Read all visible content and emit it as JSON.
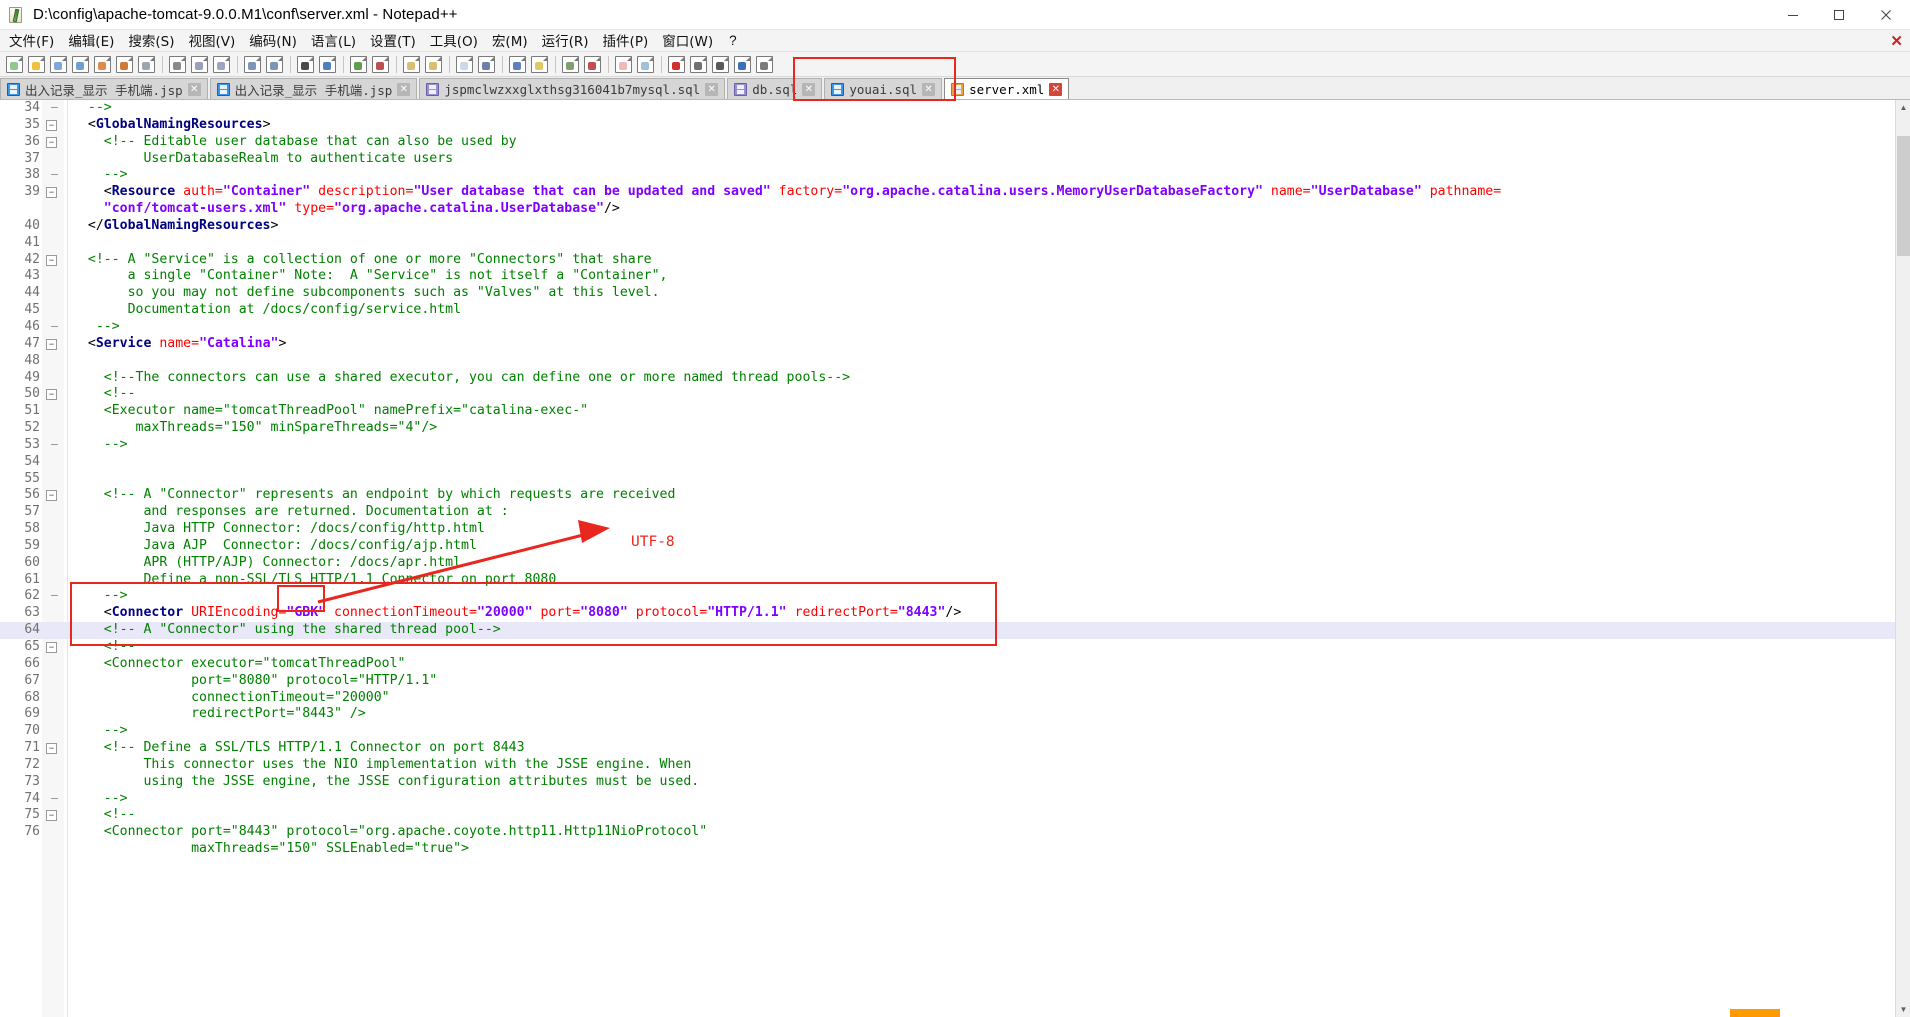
{
  "window": {
    "title": "D:\\config\\apache-tomcat-9.0.0.M1\\conf\\server.xml - Notepad++",
    "icon": "notepad-plus-plus-icon",
    "minimize": "minimize-icon",
    "maximize": "maximize-icon",
    "close": "close-icon"
  },
  "menubar": {
    "items": [
      {
        "label": "文件(F)",
        "name": "menu-file"
      },
      {
        "label": "编辑(E)",
        "name": "menu-edit"
      },
      {
        "label": "搜索(S)",
        "name": "menu-search"
      },
      {
        "label": "视图(V)",
        "name": "menu-view"
      },
      {
        "label": "编码(N)",
        "name": "menu-encoding"
      },
      {
        "label": "语言(L)",
        "name": "menu-language"
      },
      {
        "label": "设置(T)",
        "name": "menu-settings"
      },
      {
        "label": "工具(O)",
        "name": "menu-tools"
      },
      {
        "label": "宏(M)",
        "name": "menu-macro"
      },
      {
        "label": "运行(R)",
        "name": "menu-run"
      },
      {
        "label": "插件(P)",
        "name": "menu-plugins"
      },
      {
        "label": "窗口(W)",
        "name": "menu-window"
      },
      {
        "label": "?",
        "name": "menu-help"
      }
    ],
    "close_document": "✕"
  },
  "toolbar": {
    "buttons": [
      "new-file-icon",
      "open-file-icon",
      "save-icon",
      "save-all-icon",
      "close-file-icon",
      "close-all-icon",
      "print-icon",
      "sep",
      "cut-icon",
      "copy-icon",
      "paste-icon",
      "sep",
      "undo-icon",
      "redo-icon",
      "sep",
      "find-icon",
      "replace-icon",
      "sep",
      "zoom-in-icon",
      "zoom-out-icon",
      "sep",
      "sync-vertical-icon",
      "sync-horizontal-icon",
      "sep",
      "word-wrap-icon",
      "show-all-chars-icon",
      "sep",
      "indent-guide-icon",
      "bookmark-icon",
      "sep",
      "show-tab-icon",
      "user-define-dialog-icon",
      "sep",
      "folder-as-workspace-icon",
      "document-map-icon",
      "sep",
      "record-macro-icon",
      "stop-macro-icon",
      "play-macro-icon",
      "fast-playback-icon",
      "save-macro-icon"
    ]
  },
  "tabs": [
    {
      "label": "出入记录_显示 手机端.jsp",
      "icon": "blue-save-icon",
      "active": false,
      "close": "✕",
      "name": "tab-jsp-1"
    },
    {
      "label": "出入记录_显示 手机端.jsp",
      "icon": "blue-save-icon",
      "active": false,
      "close": "✕",
      "name": "tab-jsp-2"
    },
    {
      "label": "jspmclwzxxglxthsg316041b7mysql.sql",
      "icon": "purple-save-icon",
      "active": false,
      "close": "✕",
      "name": "tab-sql-1"
    },
    {
      "label": "db.sql",
      "icon": "purple-save-icon",
      "active": false,
      "close": "✕",
      "name": "tab-db-sql"
    },
    {
      "label": "youai.sql",
      "icon": "blue-save-icon",
      "active": false,
      "close": "✕",
      "name": "tab-youai-sql"
    },
    {
      "label": "server.xml",
      "icon": "orange-save-icon",
      "active": true,
      "close": "✕",
      "name": "tab-server-xml"
    }
  ],
  "annotations": {
    "utf8_label": "UTF-8",
    "accent_color": "#e8271f",
    "boxes": [
      "server-xml-tab-box",
      "gbk-value-box",
      "connector-line-box"
    ]
  },
  "editor": {
    "first_line_number": 34,
    "highlighted_line_number": 64,
    "lines": [
      {
        "n": 34,
        "fold": "tick",
        "segs": [
          {
            "t": "  -->",
            "c": "green"
          }
        ]
      },
      {
        "n": 35,
        "fold": "box",
        "segs": [
          {
            "t": "  <",
            "c": "punct"
          },
          {
            "t": "GlobalNamingResources",
            "c": "tagname"
          },
          {
            "t": ">",
            "c": "punct"
          }
        ]
      },
      {
        "n": 36,
        "fold": "box",
        "segs": [
          {
            "t": "    <!-- Editable user database that can also be used by",
            "c": "green"
          }
        ]
      },
      {
        "n": 37,
        "fold": "",
        "segs": [
          {
            "t": "         UserDatabaseRealm to authenticate users",
            "c": "green"
          }
        ]
      },
      {
        "n": 38,
        "fold": "tick",
        "segs": [
          {
            "t": "    -->",
            "c": "green"
          }
        ]
      },
      {
        "n": 39,
        "fold": "box",
        "segs": [
          {
            "t": "    <",
            "c": "punct"
          },
          {
            "t": "Resource ",
            "c": "tagname"
          },
          {
            "t": "auth=",
            "c": "attr"
          },
          {
            "t": "\"Container\"",
            "c": "val"
          },
          {
            "t": " description=",
            "c": "attr"
          },
          {
            "t": "\"User database that can be updated and saved\"",
            "c": "val"
          },
          {
            "t": " factory=",
            "c": "attr"
          },
          {
            "t": "\"org.apache.catalina.users.MemoryUserDatabaseFactory\"",
            "c": "val"
          },
          {
            "t": " name=",
            "c": "attr"
          },
          {
            "t": "\"UserDatabase\"",
            "c": "val"
          },
          {
            "t": " pathname=",
            "c": "attr"
          }
        ]
      },
      {
        "n": null,
        "fold": "",
        "segs": [
          {
            "t": "    \"conf/tomcat-users.xml\"",
            "c": "val"
          },
          {
            "t": " type=",
            "c": "attr"
          },
          {
            "t": "\"org.apache.catalina.UserDatabase\"",
            "c": "val"
          },
          {
            "t": "/>",
            "c": "punct"
          }
        ]
      },
      {
        "n": 40,
        "fold": "",
        "segs": [
          {
            "t": "  </",
            "c": "punct"
          },
          {
            "t": "GlobalNamingResources",
            "c": "tagname"
          },
          {
            "t": ">",
            "c": "punct"
          }
        ]
      },
      {
        "n": 41,
        "fold": "",
        "segs": [
          {
            "t": "",
            "c": "punct"
          }
        ]
      },
      {
        "n": 42,
        "fold": "box",
        "segs": [
          {
            "t": "  <!-- A \"Service\" is a collection of one or more \"Connectors\" that share",
            "c": "green"
          }
        ]
      },
      {
        "n": 43,
        "fold": "",
        "segs": [
          {
            "t": "       a single \"Container\" Note:  A \"Service\" is not itself a \"Container\",",
            "c": "green"
          }
        ]
      },
      {
        "n": 44,
        "fold": "",
        "segs": [
          {
            "t": "       so you may not define subcomponents such as \"Valves\" at this level.",
            "c": "green"
          }
        ]
      },
      {
        "n": 45,
        "fold": "",
        "segs": [
          {
            "t": "       Documentation at /docs/config/service.html",
            "c": "green"
          }
        ]
      },
      {
        "n": 46,
        "fold": "tick",
        "segs": [
          {
            "t": "   -->",
            "c": "green"
          }
        ]
      },
      {
        "n": 47,
        "fold": "box",
        "segs": [
          {
            "t": "  <",
            "c": "punct"
          },
          {
            "t": "Service ",
            "c": "tagname"
          },
          {
            "t": "name=",
            "c": "attr"
          },
          {
            "t": "\"Catalina\"",
            "c": "val"
          },
          {
            "t": ">",
            "c": "punct"
          }
        ]
      },
      {
        "n": 48,
        "fold": "",
        "segs": [
          {
            "t": "",
            "c": "punct"
          }
        ]
      },
      {
        "n": 49,
        "fold": "",
        "segs": [
          {
            "t": "    <!--The connectors can use a shared executor, you can define one or more named thread pools-->",
            "c": "green"
          }
        ]
      },
      {
        "n": 50,
        "fold": "box",
        "segs": [
          {
            "t": "    <!--",
            "c": "green"
          }
        ]
      },
      {
        "n": 51,
        "fold": "",
        "segs": [
          {
            "t": "    <Executor name=\"tomcatThreadPool\" namePrefix=\"catalina-exec-\"",
            "c": "green"
          }
        ]
      },
      {
        "n": 52,
        "fold": "",
        "segs": [
          {
            "t": "        maxThreads=\"150\" minSpareThreads=\"4\"/>",
            "c": "green"
          }
        ]
      },
      {
        "n": 53,
        "fold": "tick",
        "segs": [
          {
            "t": "    -->",
            "c": "green"
          }
        ]
      },
      {
        "n": 54,
        "fold": "",
        "segs": [
          {
            "t": "",
            "c": "punct"
          }
        ]
      },
      {
        "n": 55,
        "fold": "",
        "segs": [
          {
            "t": "",
            "c": "punct"
          }
        ]
      },
      {
        "n": 56,
        "fold": "box",
        "segs": [
          {
            "t": "    <!-- A \"Connector\" represents an endpoint by which requests are received",
            "c": "green"
          }
        ]
      },
      {
        "n": 57,
        "fold": "",
        "segs": [
          {
            "t": "         and responses are returned. Documentation at :",
            "c": "green"
          }
        ]
      },
      {
        "n": 58,
        "fold": "",
        "segs": [
          {
            "t": "         Java HTTP Connector: /docs/config/http.html",
            "c": "green"
          }
        ]
      },
      {
        "n": 59,
        "fold": "",
        "segs": [
          {
            "t": "         Java AJP  Connector: /docs/config/ajp.html",
            "c": "green"
          }
        ]
      },
      {
        "n": 60,
        "fold": "",
        "segs": [
          {
            "t": "         APR (HTTP/AJP) Connector: /docs/apr.html",
            "c": "green"
          }
        ]
      },
      {
        "n": 61,
        "fold": "",
        "segs": [
          {
            "t": "         Define a non-SSL/TLS HTTP/1.1 Connector on port 8080",
            "c": "green"
          }
        ]
      },
      {
        "n": 62,
        "fold": "tick",
        "segs": [
          {
            "t": "    -->",
            "c": "green"
          }
        ]
      },
      {
        "n": 63,
        "fold": "",
        "segs": [
          {
            "t": "    <",
            "c": "punct"
          },
          {
            "t": "Connector ",
            "c": "tagname"
          },
          {
            "t": "URIEncoding=",
            "c": "attr"
          },
          {
            "t": "\"GBK\"",
            "c": "val"
          },
          {
            "t": " connectionTimeout=",
            "c": "attr"
          },
          {
            "t": "\"20000\"",
            "c": "val"
          },
          {
            "t": " port=",
            "c": "attr"
          },
          {
            "t": "\"8080\"",
            "c": "val"
          },
          {
            "t": " protocol=",
            "c": "attr"
          },
          {
            "t": "\"HTTP/1.1\"",
            "c": "val"
          },
          {
            "t": " redirectPort=",
            "c": "attr"
          },
          {
            "t": "\"8443\"",
            "c": "val"
          },
          {
            "t": "/>",
            "c": "punct"
          }
        ]
      },
      {
        "n": 64,
        "fold": "",
        "hl": true,
        "segs": [
          {
            "t": "    <!-- A \"Connector\" using the shared thread pool-->",
            "c": "green"
          }
        ]
      },
      {
        "n": 65,
        "fold": "box",
        "segs": [
          {
            "t": "    <!--",
            "c": "green"
          }
        ]
      },
      {
        "n": 66,
        "fold": "",
        "segs": [
          {
            "t": "    <Connector executor=\"tomcatThreadPool\"",
            "c": "green"
          }
        ]
      },
      {
        "n": 67,
        "fold": "",
        "segs": [
          {
            "t": "               port=\"8080\" protocol=\"HTTP/1.1\"",
            "c": "green"
          }
        ]
      },
      {
        "n": 68,
        "fold": "",
        "segs": [
          {
            "t": "               connectionTimeout=\"20000\"",
            "c": "green"
          }
        ]
      },
      {
        "n": 69,
        "fold": "",
        "segs": [
          {
            "t": "               redirectPort=\"8443\" />",
            "c": "green"
          }
        ]
      },
      {
        "n": 70,
        "fold": "",
        "segs": [
          {
            "t": "    -->",
            "c": "green"
          }
        ]
      },
      {
        "n": 71,
        "fold": "box",
        "segs": [
          {
            "t": "    <!-- Define a SSL/TLS HTTP/1.1 Connector on port 8443",
            "c": "green"
          }
        ]
      },
      {
        "n": 72,
        "fold": "",
        "segs": [
          {
            "t": "         This connector uses the NIO implementation with the JSSE engine. When",
            "c": "green"
          }
        ]
      },
      {
        "n": 73,
        "fold": "",
        "segs": [
          {
            "t": "         using the JSSE engine, the JSSE configuration attributes must be used.",
            "c": "green"
          }
        ]
      },
      {
        "n": 74,
        "fold": "tick",
        "segs": [
          {
            "t": "    -->",
            "c": "green"
          }
        ]
      },
      {
        "n": 75,
        "fold": "box",
        "segs": [
          {
            "t": "    <!--",
            "c": "green"
          }
        ]
      },
      {
        "n": 76,
        "fold": "",
        "segs": [
          {
            "t": "    <Connector port=\"8443\" protocol=\"org.apache.coyote.http11.Http11NioProtocol\"",
            "c": "green"
          }
        ]
      },
      {
        "n": null,
        "fold": "",
        "segs": [
          {
            "t": "               maxThreads=\"150\" SSLEnabled=\"true\">",
            "c": "green"
          }
        ]
      }
    ]
  },
  "scrollbar": {
    "up_arrow": "▲",
    "down_arrow": "▼"
  }
}
